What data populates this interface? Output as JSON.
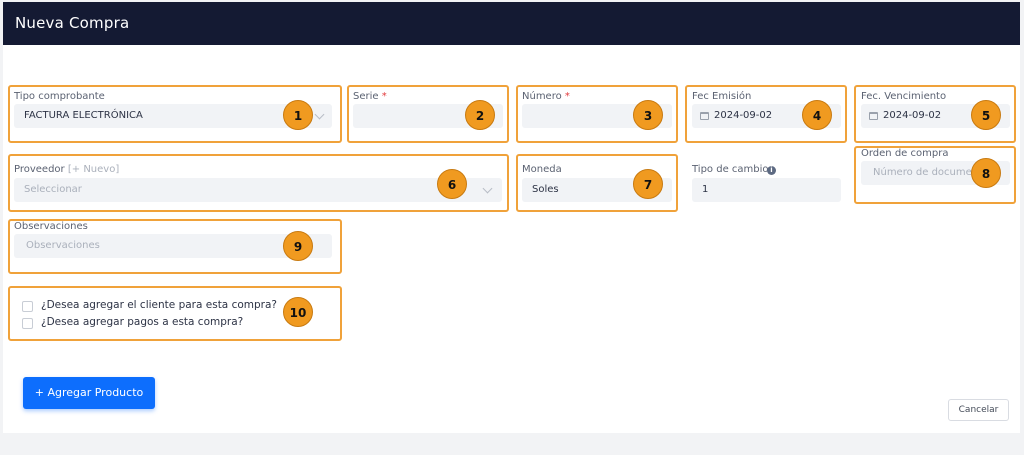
{
  "header": {
    "title": "Nueva Compra"
  },
  "form": {
    "tipo_comprobante": {
      "label": "Tipo comprobante",
      "value": "FACTURA ELECTRÓNICA"
    },
    "serie": {
      "label": "Serie",
      "required_mark": "*",
      "value": ""
    },
    "numero": {
      "label": "Número",
      "required_mark": "*",
      "value": ""
    },
    "fec_emision": {
      "label": "Fec Emisión",
      "value": "2024-09-02"
    },
    "fec_vencimiento": {
      "label": "Fec. Vencimiento",
      "value": "2024-09-02"
    },
    "proveedor": {
      "label": "Proveedor",
      "new_link": "[+ Nuevo]",
      "placeholder": "Seleccionar"
    },
    "moneda": {
      "label": "Moneda",
      "value": "Soles"
    },
    "tipo_cambio": {
      "label": "Tipo de cambio",
      "info_glyph": "i",
      "value": "1"
    },
    "orden_compra": {
      "label": "Orden de compra",
      "placeholder": "Número de documento"
    },
    "observaciones": {
      "label": "Observaciones",
      "placeholder": "Observaciones"
    },
    "checks": [
      {
        "label": "¿Desea agregar el cliente para esta compra?",
        "checked": false
      },
      {
        "label": "¿Desea agregar pagos a esta compra?",
        "checked": false
      }
    ]
  },
  "annotations": [
    "1",
    "2",
    "3",
    "4",
    "5",
    "6",
    "7",
    "8",
    "9",
    "10"
  ],
  "actions": {
    "add_product": "+ Agregar Producto",
    "cancel": "Cancelar"
  },
  "colors": {
    "header_bg": "#141a33",
    "highlight": "#f0a23a",
    "badge": "#f09a20",
    "primary": "#0d6efd",
    "required": "#e2393b"
  },
  "icons": {
    "select": "chevron-down-icon",
    "date": "calendar-icon",
    "info": "info-icon"
  }
}
